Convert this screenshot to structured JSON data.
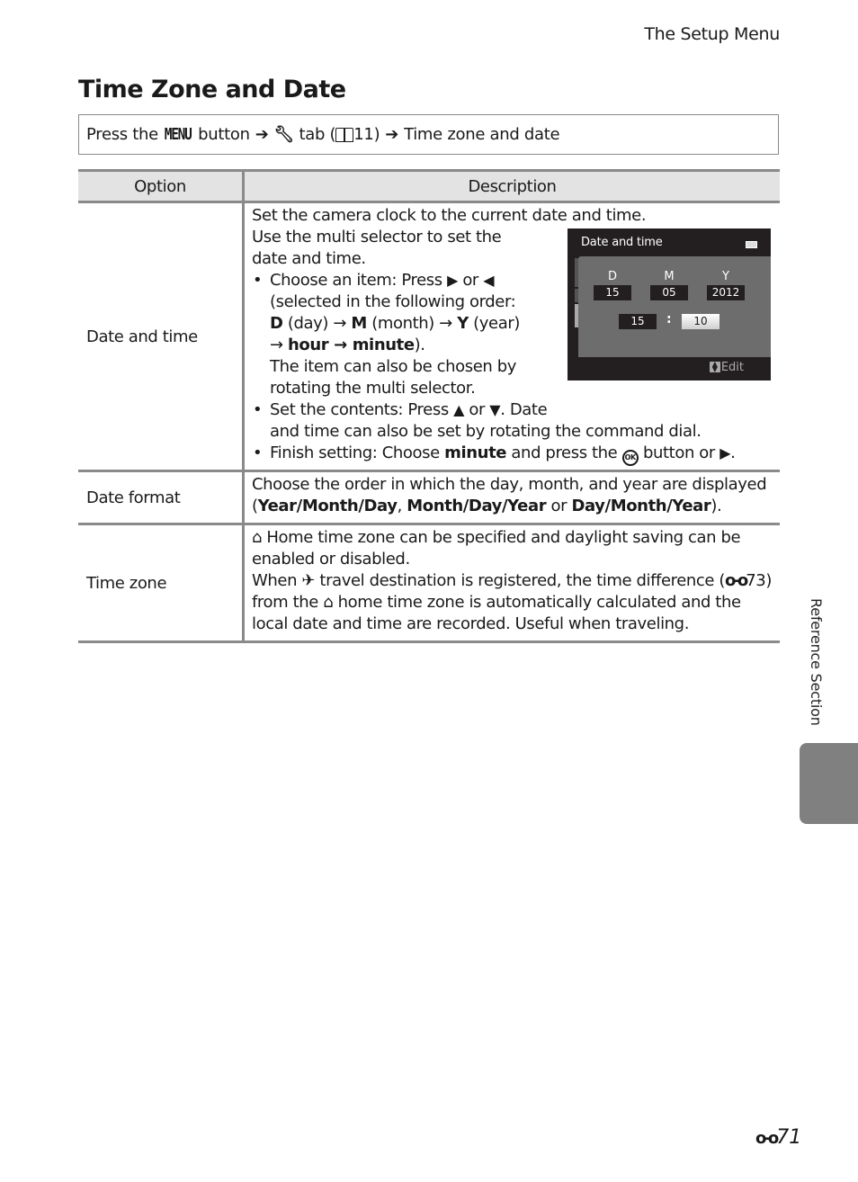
{
  "header": {
    "section": "The Setup Menu"
  },
  "page": {
    "title": "Time Zone and Date",
    "number": "71",
    "side_label": "Reference Section"
  },
  "nav_path": {
    "prefix": "Press the",
    "menu_button": "MENU",
    "button_word": "button",
    "arrow": "➔",
    "tab_icon": "wrench-icon",
    "tab_word": "tab (",
    "page_ref": "11)",
    "destination": "Time zone and date"
  },
  "table": {
    "headers": [
      "Option",
      "Description"
    ],
    "rows": [
      {
        "option": "Date and time",
        "intro": "Set the camera clock to the current date and time.",
        "intro2": "Use the multi selector to set the date and time.",
        "bullets": [
          {
            "a": "Choose an item: Press ",
            "tri1": "▶",
            "or": " or ",
            "tri2": "◀",
            "b": " (selected in the following order: ",
            "D": "D",
            "c": " (day) → ",
            "M": "M",
            "d": " (month) → ",
            "Y": "Y",
            "e": " (year) → ",
            "hour": "hour → minute",
            "f": ").",
            "extra": "The item can also be chosen by rotating the multi selector."
          },
          {
            "a": "Set the contents: Press ",
            "tri1": "▲",
            "or": " or ",
            "tri2": "▼",
            "b": ". Date",
            "c": "and time can also be set by rotating the command dial."
          },
          {
            "a": "Finish setting: Choose ",
            "minute": "minute",
            "b": " and press the ",
            "ok": "OK",
            "c": " button or ",
            "tri": "▶",
            "d": "."
          }
        ],
        "screen": {
          "title": "Date and time",
          "labels": [
            "D",
            "M",
            "Y"
          ],
          "values": [
            "15",
            "05",
            "2012"
          ],
          "hour": "15",
          "colon": ":",
          "minute": "10",
          "edit_label": "Edit"
        }
      },
      {
        "option": "Date format",
        "a": "Choose the order in which the day, month, and year are displayed (",
        "f1": "Year/Month/Day",
        "sep1": ", ",
        "f2": "Month/Day/Year",
        "sep2": " or ",
        "f3": "Day/Month/Year",
        "end": ")."
      },
      {
        "option": "Time zone",
        "line1": " Home time zone can be specified and daylight saving can be enabled or disabled.",
        "when": "When ",
        "line2": " travel destination is registered, the time difference (",
        "ref": "73",
        "line3": ") from the ",
        "line4": " home time zone is automatically calculated and the local date and time are recorded. Useful when traveling."
      }
    ]
  }
}
